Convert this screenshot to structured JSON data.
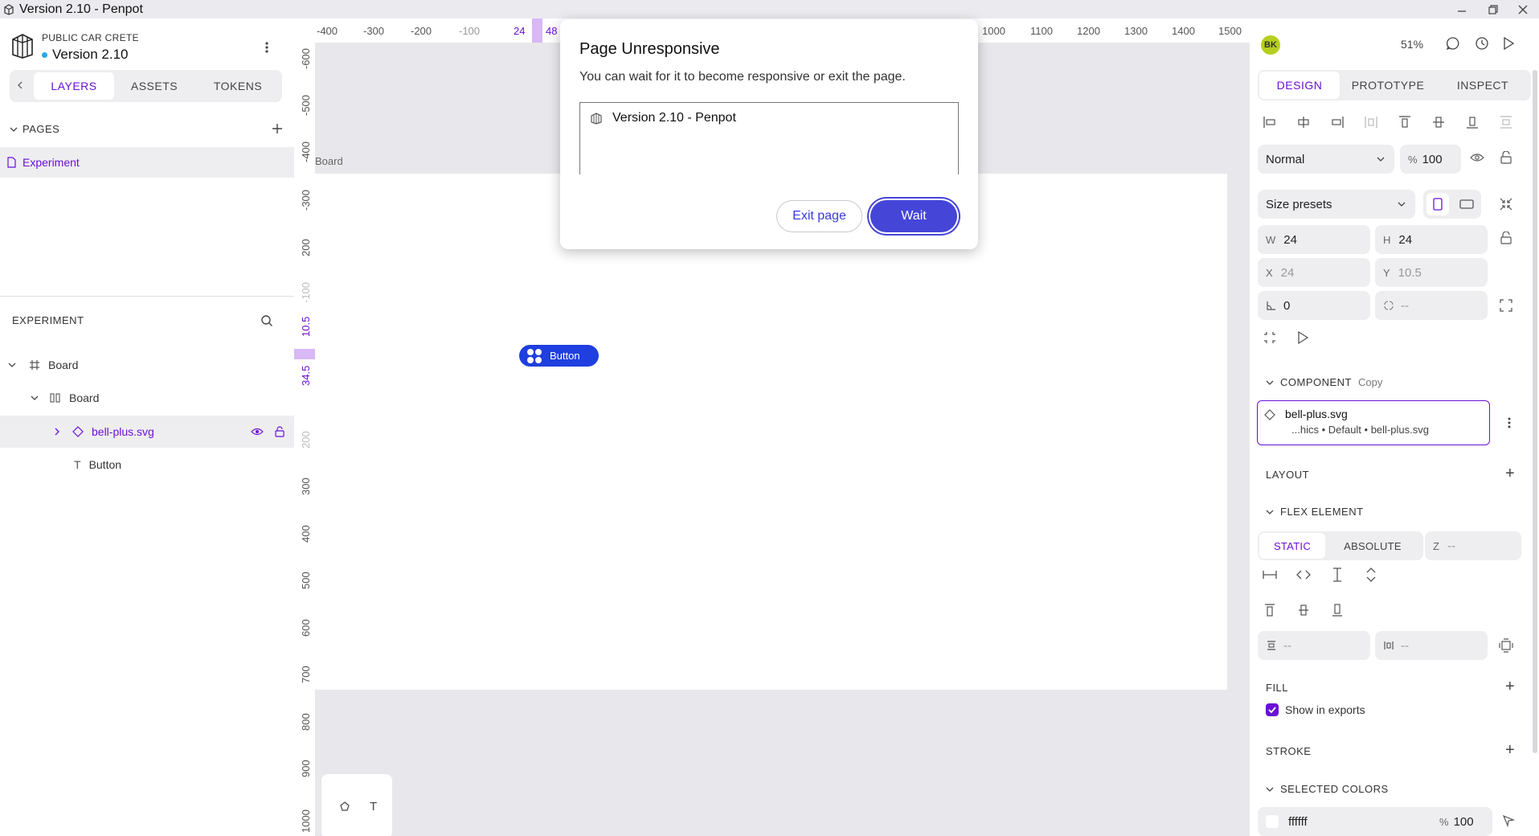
{
  "window": {
    "title": "Version 2.10 - Penpot"
  },
  "project": {
    "team": "PUBLIC CAR CRETE",
    "file": "Version 2.10"
  },
  "left_tabs": [
    "LAYERS",
    "ASSETS",
    "TOKENS"
  ],
  "pages": {
    "header": "PAGES",
    "items": [
      "Experiment"
    ]
  },
  "layers": {
    "header": "EXPERIMENT",
    "items": [
      "Board",
      "Board",
      "bell-plus.svg",
      "Button"
    ]
  },
  "rulers": {
    "horizontal": [
      "-400",
      "-300",
      "-200",
      "-100",
      "24",
      "48",
      "1000",
      "1100",
      "1200",
      "1300",
      "1400",
      "1500"
    ],
    "vertical": [
      "-600",
      "-500",
      "-400",
      "-300",
      "200",
      "-100",
      "10.5",
      "34.5",
      "200",
      "300",
      "400",
      "500",
      "600",
      "700",
      "800",
      "900",
      "1000"
    ]
  },
  "canvas": {
    "board_label": "Board",
    "button_text": "Button"
  },
  "dialog": {
    "title": "Page Unresponsive",
    "message": "You can wait for it to become responsive or exit the page.",
    "page_item": "Version 2.10 - Penpot",
    "exit_label": "Exit page",
    "wait_label": "Wait"
  },
  "right": {
    "avatar": "BK",
    "zoom": "51%",
    "tabs": [
      "DESIGN",
      "PROTOTYPE",
      "INSPECT"
    ],
    "blend": "Normal",
    "opacity_unit": "%",
    "opacity": "100",
    "size_presets": "Size presets",
    "w_label": "W",
    "w": "24",
    "h_label": "H",
    "h": "24",
    "x_label": "X",
    "x": "24",
    "y_label": "Y",
    "y": "10.5",
    "rotation": "0",
    "radius": "--",
    "component_header": "COMPONENT",
    "component_copy": "Copy",
    "component_name": "bell-plus.svg",
    "component_path": "...hics • Default • bell-plus.svg",
    "layout_header": "LAYOUT",
    "flex_header": "FLEX ELEMENT",
    "static_label": "STATIC",
    "absolute_label": "ABSOLUTE",
    "z_label": "Z",
    "z_value": "--",
    "margin_v": "--",
    "margin_h": "--",
    "fill_header": "FILL",
    "show_exports": "Show in exports",
    "stroke_header": "STROKE",
    "selected_colors_header": "SELECTED COLORS",
    "color_hex": "ffffff",
    "color_opacity_unit": "%",
    "color_opacity": "100"
  },
  "colors": {
    "accent": "#6911d4",
    "dialog_button": "#4545d8",
    "canvas_button": "#1f3fe0"
  }
}
